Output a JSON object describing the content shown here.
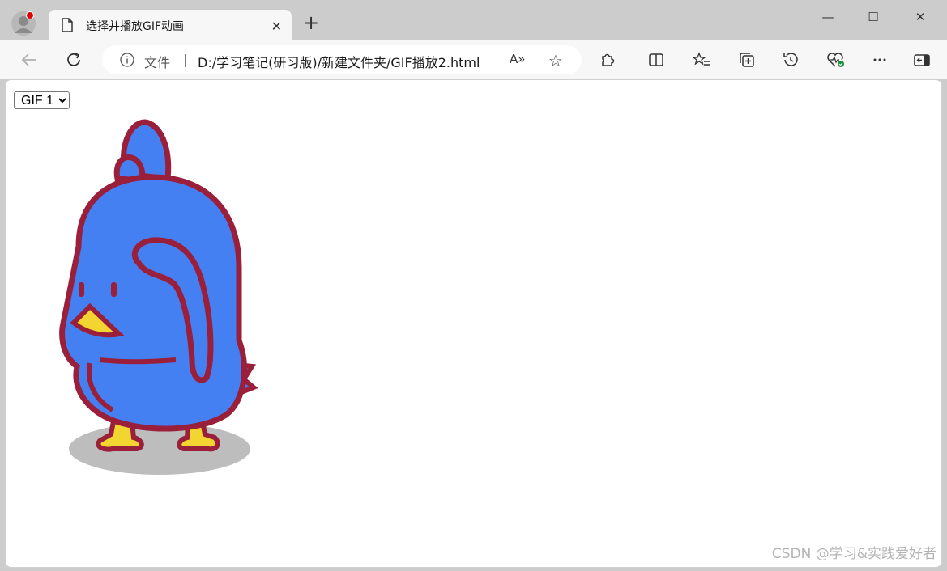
{
  "tab": {
    "title": "选择并播放GIF动画",
    "close": "✕"
  },
  "new_tab": "+",
  "window": {
    "minimize": "—",
    "maximize": "☐",
    "close": "✕"
  },
  "address": {
    "file_label": "文件",
    "separator": "|",
    "url": "D:/学习笔记(研习版)/新建文件夹/GIF播放2.html",
    "read_aloud": "A»"
  },
  "toolbar_icons": [
    "back-icon",
    "refresh-icon",
    "extensions-icon",
    "split-screen-icon",
    "favorites-icon",
    "collections-icon",
    "history-icon",
    "browser-essentials-icon",
    "more-icon",
    "sidebar-icon"
  ],
  "page": {
    "select_value": "GIF 1",
    "select_options": [
      "GIF 1"
    ],
    "watermark": "CSDN @学习&实践爱好者"
  },
  "colors": {
    "bird_body": "#4580f2",
    "bird_outline": "#9a1f3a",
    "beak": "#f3d531",
    "shadow": "#bdbdbd"
  }
}
